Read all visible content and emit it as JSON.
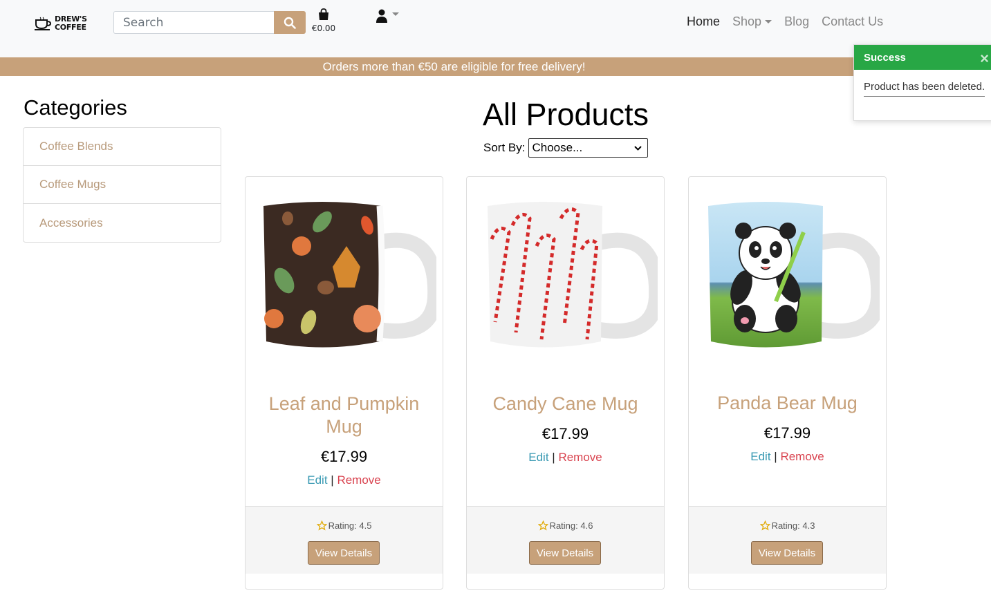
{
  "header": {
    "logo_line1": "DREW'S",
    "logo_line2": "COFFEE",
    "search_placeholder": "Search",
    "bag_total": "€0.00",
    "nav": [
      {
        "label": "Home"
      },
      {
        "label": "Shop"
      },
      {
        "label": "Blog"
      },
      {
        "label": "Contact Us"
      }
    ]
  },
  "banner": {
    "text": "Orders more than €50 are eligible for free delivery!"
  },
  "toast": {
    "title": "Success",
    "message": "Product has been deleted."
  },
  "sidebar": {
    "title": "Categories",
    "items": [
      {
        "label": "Coffee Blends"
      },
      {
        "label": "Coffee Mugs"
      },
      {
        "label": "Accessories"
      }
    ]
  },
  "main": {
    "title": "All Products",
    "sort_label": "Sort By:",
    "sort_value": "Choose...",
    "products": [
      {
        "name": "Leaf and Pumpkin Mug",
        "price": "€17.99",
        "edit": "Edit",
        "remove": "Remove",
        "rating": "Rating: 4.5",
        "button": "View Details",
        "image_icon": "leaf-pumpkin-mug-image"
      },
      {
        "name": "Candy Cane Mug",
        "price": "€17.99",
        "edit": "Edit",
        "remove": "Remove",
        "rating": "Rating: 4.6",
        "button": "View Details",
        "image_icon": "candy-cane-mug-image"
      },
      {
        "name": "Panda Bear Mug",
        "price": "€17.99",
        "edit": "Edit",
        "remove": "Remove",
        "rating": "Rating: 4.3",
        "button": "View Details",
        "image_icon": "panda-bear-mug-image"
      }
    ]
  },
  "colors": {
    "brand": "#c7a17a",
    "success": "#28a745",
    "edit_link": "#3a9ab3",
    "remove_link": "#d9434f"
  }
}
